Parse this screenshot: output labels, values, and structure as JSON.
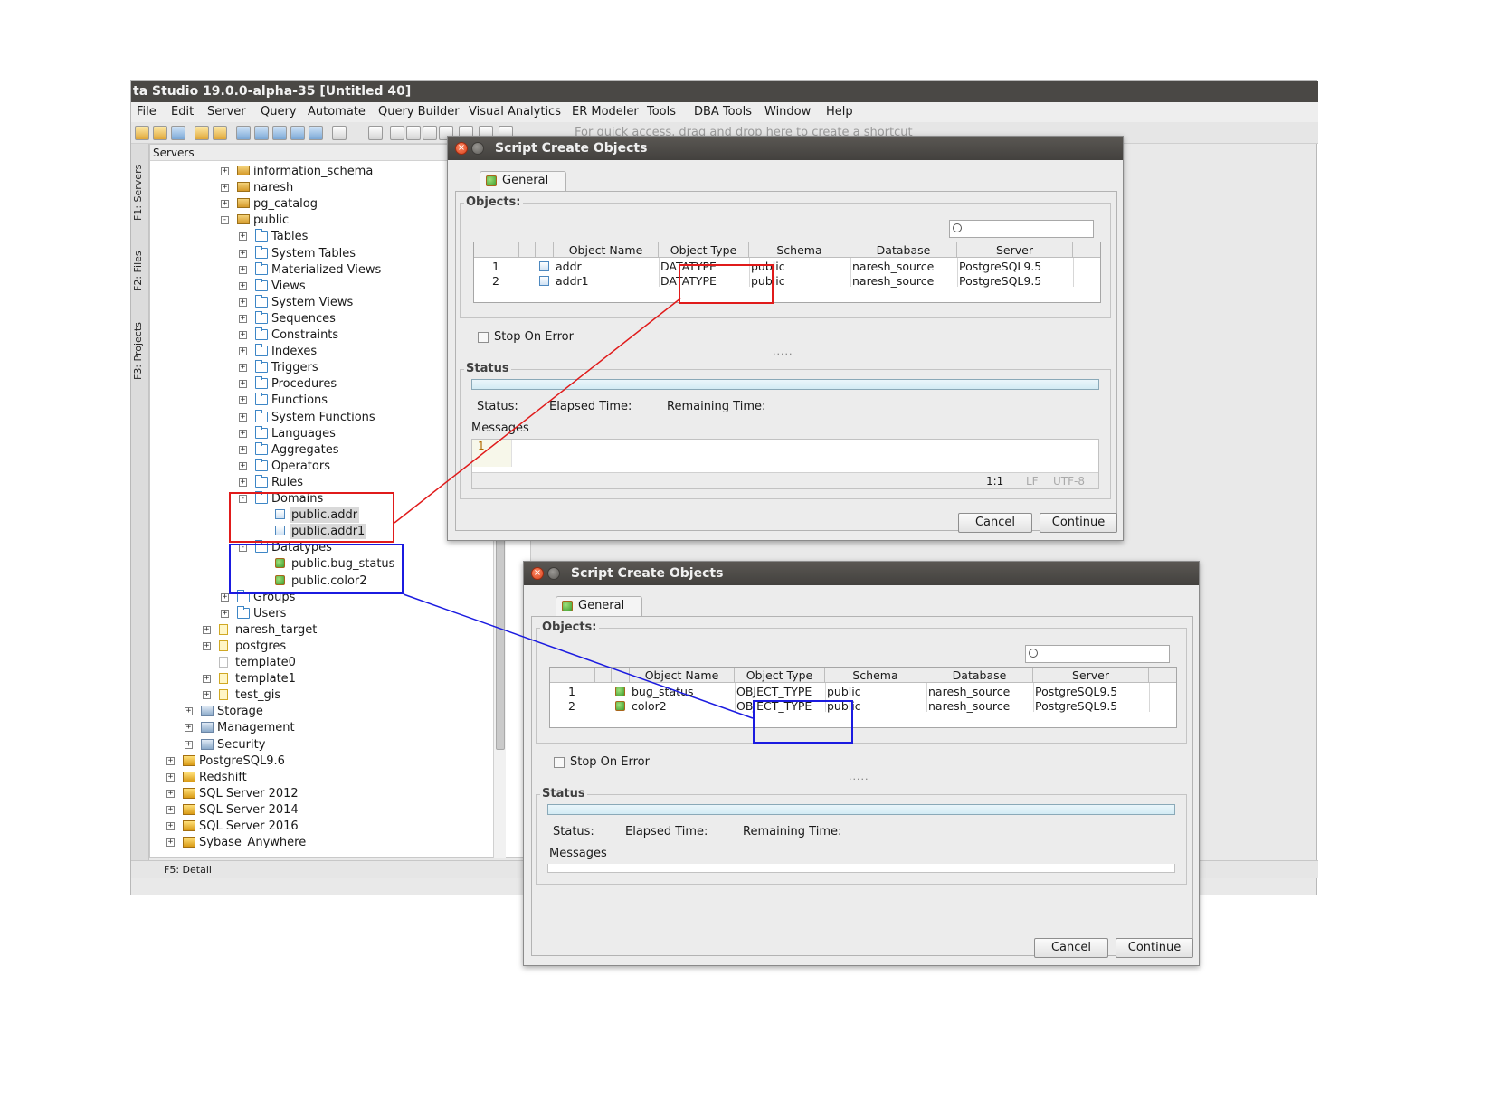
{
  "app": {
    "title": "ta Studio 19.0.0-alpha-35 [Untitled 40]",
    "menu": [
      "File",
      "Edit",
      "Server",
      "Query",
      "Automate",
      "Query Builder",
      "Visual Analytics",
      "ER Modeler",
      "Tools",
      "DBA Tools",
      "Window",
      "Help"
    ],
    "shortcut_hint": "For quick access, drag and drop here to create a shortcut",
    "vtabs": [
      "F1: Servers",
      "F2: Files",
      "F3: Projects"
    ],
    "status_tab": "F5: Detail"
  },
  "servers": {
    "header": "Servers",
    "tree": [
      {
        "label": "information_schema",
        "expander": "+",
        "icon": "schema-icon"
      },
      {
        "label": "naresh",
        "expander": "+",
        "icon": "schema-icon"
      },
      {
        "label": "pg_catalog",
        "expander": "+",
        "icon": "schema-icon"
      },
      {
        "label": "public",
        "expander": "-",
        "icon": "schema-icon"
      },
      {
        "label": "Tables",
        "expander": "+",
        "icon": "folder-icon"
      },
      {
        "label": "System Tables",
        "expander": "+",
        "icon": "folder-icon"
      },
      {
        "label": "Materialized Views",
        "expander": "+",
        "icon": "folder-icon"
      },
      {
        "label": "Views",
        "expander": "+",
        "icon": "folder-icon"
      },
      {
        "label": "System Views",
        "expander": "+",
        "icon": "folder-icon"
      },
      {
        "label": "Sequences",
        "expander": "+",
        "icon": "folder-icon"
      },
      {
        "label": "Constraints",
        "expander": "+",
        "icon": "folder-icon"
      },
      {
        "label": "Indexes",
        "expander": "+",
        "icon": "folder-icon"
      },
      {
        "label": "Triggers",
        "expander": "+",
        "icon": "folder-icon"
      },
      {
        "label": "Procedures",
        "expander": "+",
        "icon": "folder-icon"
      },
      {
        "label": "Functions",
        "expander": "+",
        "icon": "folder-icon"
      },
      {
        "label": "System Functions",
        "expander": "+",
        "icon": "folder-icon"
      },
      {
        "label": "Languages",
        "expander": "+",
        "icon": "folder-icon"
      },
      {
        "label": "Aggregates",
        "expander": "+",
        "icon": "folder-icon"
      },
      {
        "label": "Operators",
        "expander": "+",
        "icon": "folder-icon"
      },
      {
        "label": "Rules",
        "expander": "+",
        "icon": "folder-icon"
      },
      {
        "label": "Domains",
        "expander": "-",
        "icon": "folder-icon"
      },
      {
        "label": "public.addr",
        "expander": "",
        "icon": "domain-icon",
        "selected": true
      },
      {
        "label": "public.addr1",
        "expander": "",
        "icon": "domain-icon",
        "selected": true
      },
      {
        "label": "Datatypes",
        "expander": "-",
        "icon": "folder-icon"
      },
      {
        "label": "public.bug_status",
        "expander": "",
        "icon": "datatype-icon"
      },
      {
        "label": "public.color2",
        "expander": "",
        "icon": "datatype-icon"
      },
      {
        "label": "Groups",
        "expander": "+",
        "icon": "folder-icon"
      },
      {
        "label": "Users",
        "expander": "+",
        "icon": "folder-icon"
      },
      {
        "label": "naresh_target",
        "expander": "+",
        "icon": "database-icon"
      },
      {
        "label": "postgres",
        "expander": "+",
        "icon": "database-icon"
      },
      {
        "label": "template0",
        "expander": "",
        "icon": "database-gray-icon"
      },
      {
        "label": "template1",
        "expander": "+",
        "icon": "database-icon"
      },
      {
        "label": "test_gis",
        "expander": "+",
        "icon": "database-icon"
      },
      {
        "label": "Storage",
        "expander": "+",
        "icon": "storage-icon"
      },
      {
        "label": "Management",
        "expander": "+",
        "icon": "management-icon"
      },
      {
        "label": "Security",
        "expander": "+",
        "icon": "security-icon"
      },
      {
        "label": "PostgreSQL9.6",
        "expander": "+",
        "icon": "server-icon"
      },
      {
        "label": "Redshift",
        "expander": "+",
        "icon": "server-icon"
      },
      {
        "label": "SQL Server 2012",
        "expander": "+",
        "icon": "server-icon"
      },
      {
        "label": "SQL Server 2014",
        "expander": "+",
        "icon": "server-icon"
      },
      {
        "label": "SQL Server 2016",
        "expander": "+",
        "icon": "server-icon"
      },
      {
        "label": "Sybase_Anywhere",
        "expander": "+",
        "icon": "server-icon"
      }
    ]
  },
  "dialog1": {
    "title": "Script Create Objects",
    "tab": "General",
    "objects_label": "Objects:",
    "columns": [
      "Object Name",
      "Object Type",
      "Schema",
      "Database",
      "Server"
    ],
    "rows": [
      {
        "num": "1",
        "name": "addr",
        "type": "DATATYPE",
        "schema": "public",
        "database": "naresh_source",
        "server": "PostgreSQL9.5"
      },
      {
        "num": "2",
        "name": "addr1",
        "type": "DATATYPE",
        "schema": "public",
        "database": "naresh_source",
        "server": "PostgreSQL9.5"
      }
    ],
    "stop_on_error": "Stop On Error",
    "dots": ".....",
    "status_title": "Status",
    "status_label": "Status:",
    "elapsed_label": "Elapsed Time:",
    "remaining_label": "Remaining Time:",
    "messages_label": "Messages",
    "line_number": "1",
    "cursor_pos": "1:1",
    "line_ending": "LF",
    "encoding": "UTF-8",
    "cancel": "Cancel",
    "continue": "Continue"
  },
  "dialog2": {
    "title": "Script Create Objects",
    "tab": "General",
    "objects_label": "Objects:",
    "columns": [
      "Object Name",
      "Object Type",
      "Schema",
      "Database",
      "Server"
    ],
    "rows": [
      {
        "num": "1",
        "name": "bug_status",
        "type": "OBJECT_TYPE",
        "schema": "public",
        "database": "naresh_source",
        "server": "PostgreSQL9.5"
      },
      {
        "num": "2",
        "name": "color2",
        "type": "OBJECT_TYPE",
        "schema": "public",
        "database": "naresh_source",
        "server": "PostgreSQL9.5"
      }
    ],
    "stop_on_error": "Stop On Error",
    "dots": ".....",
    "status_title": "Status",
    "status_label": "Status:",
    "elapsed_label": "Elapsed Time:",
    "remaining_label": "Remaining Time:",
    "messages_label": "Messages",
    "cancel": "Cancel",
    "continue": "Continue"
  },
  "annotations": {
    "red": "#e01b1b",
    "blue": "#1b1be0"
  }
}
